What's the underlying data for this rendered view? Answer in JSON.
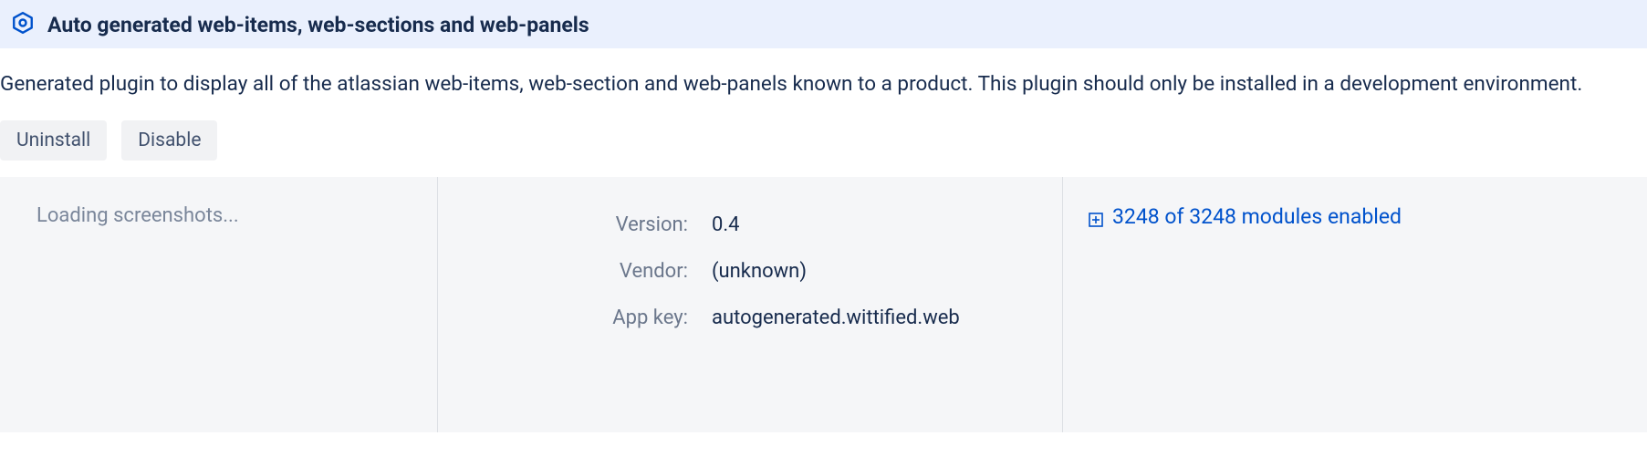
{
  "header": {
    "title": "Auto generated web-items, web-sections and web-panels"
  },
  "description": "Generated plugin to display all of the atlassian web-items, web-section and web-panels known to a product. This plugin should only be installed in a development environment.",
  "buttons": {
    "uninstall": "Uninstall",
    "disable": "Disable"
  },
  "left_panel": {
    "loading_text": "Loading screenshots..."
  },
  "details": {
    "version_label": "Version:",
    "version_value": "0.4",
    "vendor_label": "Vendor:",
    "vendor_value": "(unknown)",
    "appkey_label": "App key:",
    "appkey_value": "autogenerated.wittified.web"
  },
  "modules": {
    "link_text": "3248 of 3248 modules enabled"
  }
}
